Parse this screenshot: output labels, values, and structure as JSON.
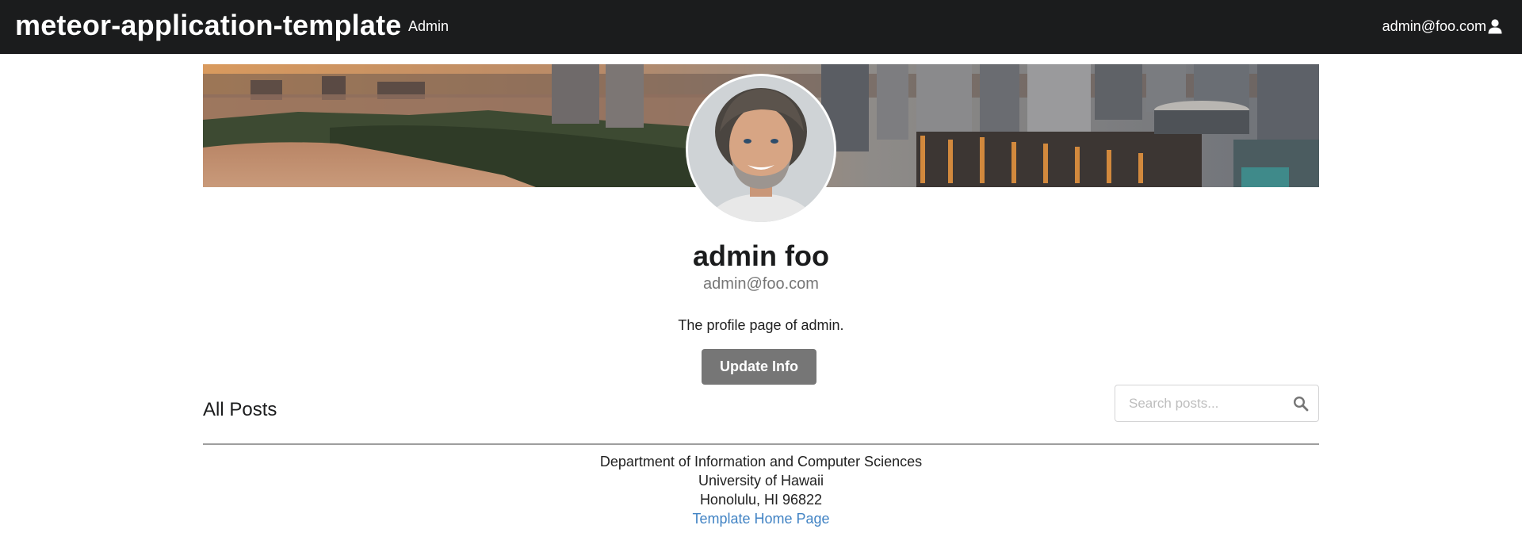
{
  "navbar": {
    "brand": "meteor-application-template",
    "links": [
      {
        "label": "Admin"
      }
    ],
    "user": {
      "label": "admin@foo.com",
      "icon": "user-icon"
    },
    "background": "#1b1c1d"
  },
  "banner": {
    "image": "city-skyline-sunset-photo"
  },
  "profile": {
    "avatar": "profile-photo",
    "name": "admin foo",
    "email": "admin@foo.com",
    "bio": "The profile page of admin.",
    "update_button_label": "Update Info",
    "button_color": "#767676"
  },
  "posts": {
    "title": "All Posts",
    "search_placeholder": "Search posts...",
    "search_icon": "search-icon"
  },
  "footer": {
    "lines": [
      "Department of Information and Computer Sciences",
      "University of Hawaii",
      "Honolulu, HI 96822"
    ],
    "link_label": "Template Home Page",
    "link_color": "#4183c4"
  }
}
